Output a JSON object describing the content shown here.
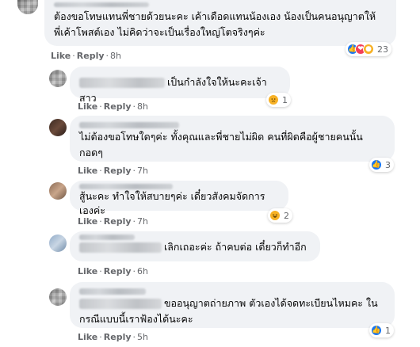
{
  "comments": [
    {
      "text": "ต้องขอโทษแทนพี่ชายด้วยนะคะ เค้าเดือดแทนน้องเอง น้องเป็นคนอนุญาตให้พี่เค้าโพสต์เอง ไม่คิดว่าจะเป็นเรื่องใหญ่โตจริงๆค่ะ",
      "line1": "ต้องขอโทษแทนพี่ชายด้วยนะคะ เค้าเดือดแทนน้องเอง น้องเป็นคนอนุญาตให้",
      "line2": "พี่เค้าโพสต์เอง ไม่คิดว่าจะเป็นเรื่องใหญ่โตจริงๆค่ะ",
      "like": "Like",
      "reply": "Reply",
      "time": "8h",
      "reaction_count": "23",
      "reaction_icons": [
        "like-icon",
        "love-icon",
        "wow-icon"
      ]
    },
    {
      "text": "เป็นกำลังใจให้นะคะเจ้าสาว",
      "like": "Like",
      "reply": "Reply",
      "time": "8h",
      "reaction_count": "1",
      "reaction_icons": [
        "sad-icon"
      ]
    },
    {
      "line1": "ไม่ต้องขอโทษใดๆค่ะ ทั้งคุณและพี่ชายไม่ผิด คนที่ผิดคือผู้ชายคนนั้น",
      "line2": "กอดๆ",
      "like": "Like",
      "reply": "Reply",
      "time": "7h",
      "reaction_count": "3",
      "reaction_icons": [
        "like-icon"
      ]
    },
    {
      "text": "สู้นะคะ ทำใจให้สบายๆค่ะ เดี๋ยวสังคมจัดการเองค่ะ",
      "like": "Like",
      "reply": "Reply",
      "time": "7h",
      "reaction_count": "2",
      "reaction_icons": [
        "haha-icon"
      ]
    },
    {
      "text": "เลิกเถอะค่ะ ถ้าคบต่อ เดี๋ยวก็ทำอีก",
      "like": "Like",
      "reply": "Reply",
      "time": "6h"
    },
    {
      "line1": "ขออนุญาตถ่ายภาพ ตัวเองได้จดทะเบียนไหมคะ ใน",
      "line2": "กรณีแบบนี้เราฟ้องได้นะคะ",
      "like": "Like",
      "reply": "Reply",
      "time": "5h",
      "reaction_count": "1",
      "reaction_icons": [
        "like-icon"
      ]
    }
  ],
  "colors": {
    "bubble": "#f0f2f5",
    "meta": "#65676b",
    "like_blue": "#1877f2",
    "love_red": "#f33e58",
    "haha_yellow": "#f7b125"
  }
}
